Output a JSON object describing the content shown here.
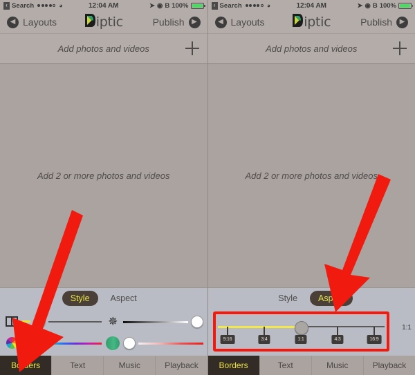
{
  "statusbar": {
    "back_glyph": "‹",
    "carrier": "Search",
    "signal_dots": 5,
    "signal_filled": 4,
    "wifi_icon": "wifi-icon",
    "time": "12:04 AM",
    "location_icon": "location-arrow-icon",
    "alarm_icon": "alarm-icon",
    "bluetooth_icon": "bluetooth-icon",
    "battery_percent": "100%"
  },
  "navbar": {
    "back_label": "Layouts",
    "back_icon": "chevron-left-circle-icon",
    "brand": "iptic",
    "brand_logo": "diptic-d-logo",
    "publish_label": "Publish",
    "publish_icon": "chevron-right-circle-icon"
  },
  "addbar": {
    "label": "Add photos and videos",
    "plus_icon": "plus-icon"
  },
  "canvas": {
    "hint": "Add 2 or more photos and videos"
  },
  "segments": {
    "style_label": "Style",
    "aspect_label": "Aspect"
  },
  "left_panel": {
    "active_segment": "Style",
    "controls": [
      {
        "icon": "border-layout-icon",
        "name": "border-width-slider",
        "knob": "gray",
        "fill": "yellow",
        "knob_pct": 6
      },
      {
        "icon": "brightness-sun-icon",
        "name": "brightness-slider",
        "knob": "white",
        "fill": "black-to-white-gradient",
        "knob_pct": 100
      },
      {
        "icon": "color-wheel-icon",
        "name": "border-color-slider",
        "knob": "white",
        "fill": "hue-spectrum",
        "knob_pct": 0
      },
      {
        "icon": "green-sphere-icon",
        "name": "saturation-slider",
        "knob": "white",
        "fill": "white-to-red-gradient",
        "knob_pct": 8
      }
    ]
  },
  "right_panel": {
    "active_segment": "Aspect",
    "aspect_slider": {
      "name": "aspect-ratio-slider",
      "ticks": [
        {
          "label": "9:16",
          "pct": 6
        },
        {
          "label": "3:4",
          "pct": 28
        },
        {
          "label": "1:1",
          "pct": 50
        },
        {
          "label": "4:3",
          "pct": 72
        },
        {
          "label": "16:9",
          "pct": 94
        }
      ],
      "value": "1:1",
      "knob_pct": 50,
      "readout": "1:1",
      "highlight_color": "#f01b0e",
      "fill_color": "#f2e84a"
    }
  },
  "tabbar": {
    "tabs": [
      {
        "label": "Borders",
        "active": true
      },
      {
        "label": "Text",
        "active": false
      },
      {
        "label": "Music",
        "active": false
      },
      {
        "label": "Playback",
        "active": false
      }
    ]
  },
  "annotations": {
    "left_arrow": "red-arrow-pointing-to-borders-tab",
    "right_arrow": "red-arrow-pointing-to-aspect-slider",
    "arrow_color": "#f01b0e"
  },
  "colors": {
    "canvas_bg": "#aba3a0",
    "bar_bg": "#b3aca9",
    "panel_bg": "#b9bcc4",
    "active_tab_bg": "#332b25",
    "active_tab_text": "#ece23f",
    "accent_red": "#f01b0e"
  }
}
